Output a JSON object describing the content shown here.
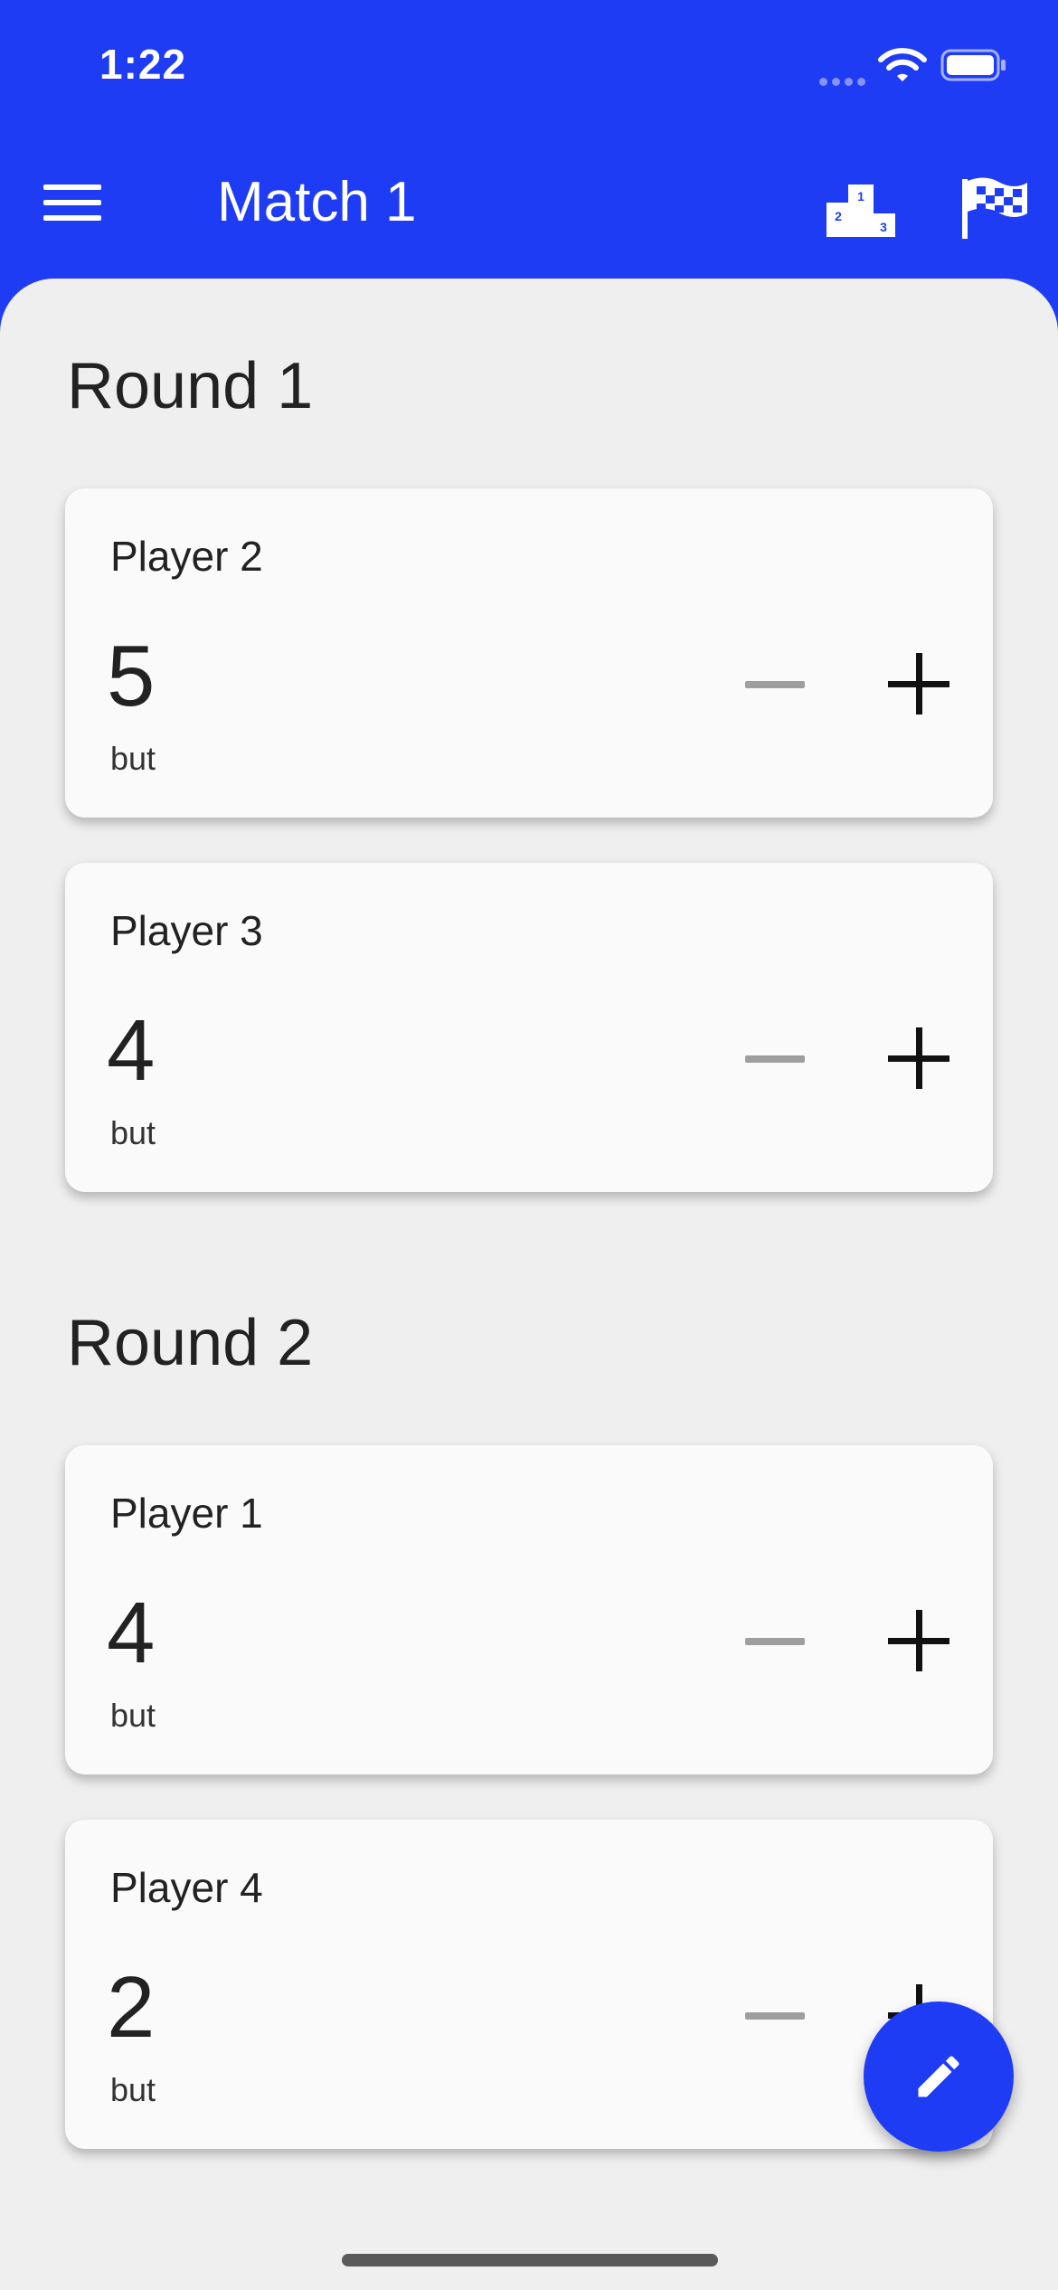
{
  "status_bar": {
    "time": "1:22"
  },
  "app_bar": {
    "title": "Match 1"
  },
  "rounds": [
    {
      "title": "Round 1",
      "players": [
        {
          "name": "Player 2",
          "score": "5",
          "unit": "but"
        },
        {
          "name": "Player 3",
          "score": "4",
          "unit": "but"
        }
      ]
    },
    {
      "title": "Round 2",
      "players": [
        {
          "name": "Player 1",
          "score": "4",
          "unit": "but"
        },
        {
          "name": "Player 4",
          "score": "2",
          "unit": "but"
        }
      ]
    }
  ],
  "icons": {
    "menu": "menu-icon",
    "podium": "podium-icon",
    "flag": "checkered-flag-icon",
    "fab": "pencil-icon"
  },
  "colors": {
    "primary": "#1f3cf5",
    "background": "#efefef",
    "card": "#fafafa",
    "disabled": "#9e9e9e"
  }
}
